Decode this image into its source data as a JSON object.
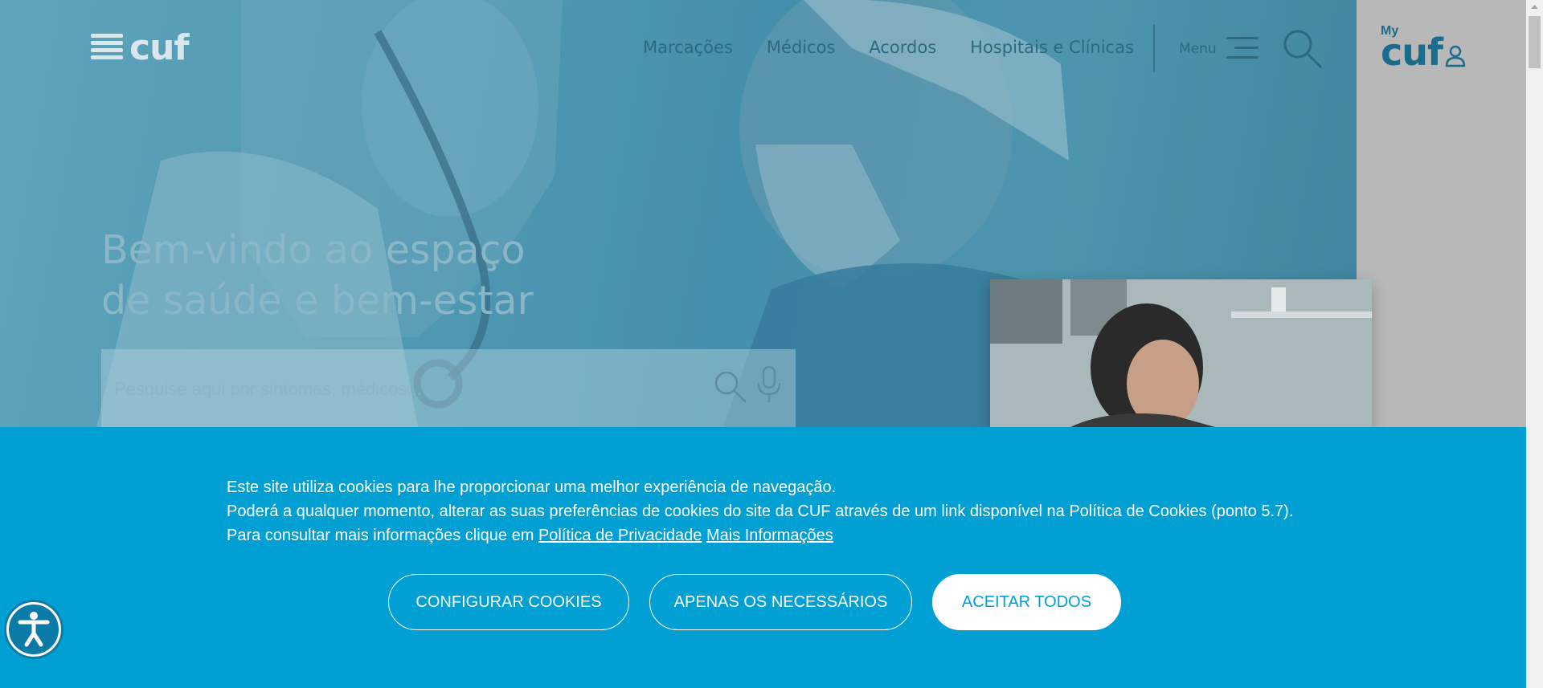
{
  "header": {
    "logo_text": "cuf",
    "nav": [
      {
        "label": "Marcações"
      },
      {
        "label": "Médicos"
      },
      {
        "label": "Acordos"
      },
      {
        "label": "Hospitais e Clínicas"
      }
    ],
    "menu_label": "Menu",
    "mycuf": {
      "my": "My",
      "cuf": "cuf"
    }
  },
  "hero": {
    "title_line1": "Bem-vindo ao espaço",
    "title_line2": "de saúde e bem-estar",
    "search_placeholder": "Pesquise aqui por sintomas, médicos..."
  },
  "cookie_banner": {
    "line1": "Este site utiliza cookies para lhe proporcionar uma melhor experiência de navegação.",
    "line2": "Poderá a qualquer momento, alterar as suas preferências de cookies do site da CUF através de um link disponível na Política de Cookies (ponto 5.7).",
    "line3_prefix": "Para consultar mais informações clique em",
    "privacy_link": "Política de Privacidade",
    "more_info_link": "Mais Informações",
    "buttons": {
      "configure": "CONFIGURAR COOKIES",
      "necessary": "APENAS OS NECESSÁRIOS",
      "accept_all": "ACEITAR TODOS"
    }
  },
  "colors": {
    "banner": "#009fd4",
    "brand_dark": "#1b6b8c",
    "hero_text": "#8ab7c7"
  }
}
